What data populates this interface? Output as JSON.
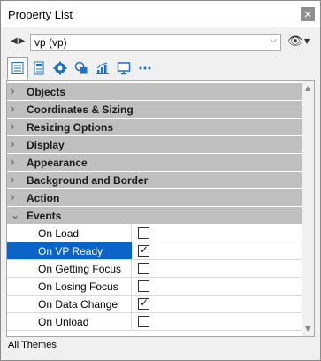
{
  "window": {
    "title": "Property List",
    "close_glyph": "×"
  },
  "selector": {
    "back_forward_glyph": "◀▶",
    "value": "vp (vp)",
    "dropdown_glyph": "⌵",
    "eye_icon": "eye-icon",
    "eye_glyph": "👁",
    "eye_dropdown_glyph": "▼"
  },
  "toolbar": {
    "buttons": [
      {
        "icon": "list-icon",
        "active": true
      },
      {
        "icon": "document-icon",
        "active": false
      },
      {
        "icon": "gear-icon",
        "active": false
      },
      {
        "icon": "shapes-icon",
        "active": false
      },
      {
        "icon": "chart-icon",
        "active": false
      },
      {
        "icon": "monitor-icon",
        "active": false
      },
      {
        "icon": "more-icon",
        "active": false
      }
    ]
  },
  "categories": [
    {
      "label": "Objects",
      "chevron": "›"
    },
    {
      "label": "Coordinates & Sizing",
      "chevron": "›"
    },
    {
      "label": "Resizing Options",
      "chevron": "›"
    },
    {
      "label": "Display",
      "chevron": "›"
    },
    {
      "label": "Appearance",
      "chevron": "›"
    },
    {
      "label": "Background and Border",
      "chevron": "›"
    },
    {
      "label": "Action",
      "chevron": "›"
    },
    {
      "label": "Events",
      "chevron": "⌄"
    }
  ],
  "events": [
    {
      "label": "On Load",
      "checked": false,
      "selected": false
    },
    {
      "label": "On VP Ready",
      "checked": true,
      "selected": true
    },
    {
      "label": "On Getting Focus",
      "checked": false,
      "selected": false
    },
    {
      "label": "On Losing Focus",
      "checked": false,
      "selected": false
    },
    {
      "label": "On Data Change",
      "checked": true,
      "selected": false
    },
    {
      "label": "On Unload",
      "checked": false,
      "selected": false
    }
  ],
  "check_glyph": "✓",
  "status": {
    "text": "All Themes"
  },
  "colors": {
    "selection": "#0a64c8",
    "category_bg": "#bfbfbf"
  }
}
